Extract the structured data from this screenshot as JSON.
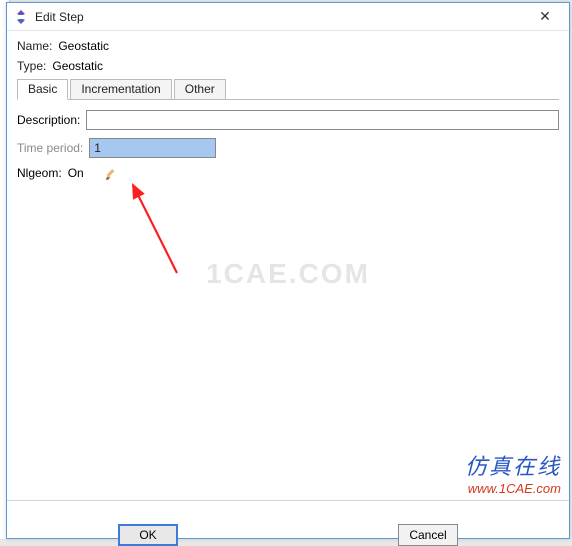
{
  "window": {
    "title": "Edit Step",
    "close_glyph": "✕"
  },
  "header": {
    "name_label": "Name:",
    "name_value": "Geostatic",
    "type_label": "Type:",
    "type_value": "Geostatic"
  },
  "tabs": {
    "items": [
      {
        "label": "Basic",
        "active": true
      },
      {
        "label": "Incrementation",
        "active": false
      },
      {
        "label": "Other",
        "active": false
      }
    ]
  },
  "basic": {
    "description_label": "Description:",
    "description_value": "",
    "time_period_label": "Time period:",
    "time_period_value": "1",
    "nlgeom_label": "Nlgeom:",
    "nlgeom_value": "On"
  },
  "buttons": {
    "ok": "OK",
    "cancel": "Cancel"
  },
  "watermark": "1CAE.COM",
  "branding": {
    "cn": "仿真在线",
    "url": "www.1CAE.com"
  },
  "icons": {
    "app": "app-icon",
    "close": "close-icon",
    "edit": "edit-pencil-icon"
  },
  "annotation": {
    "arrow_color": "#ff1e1e"
  }
}
